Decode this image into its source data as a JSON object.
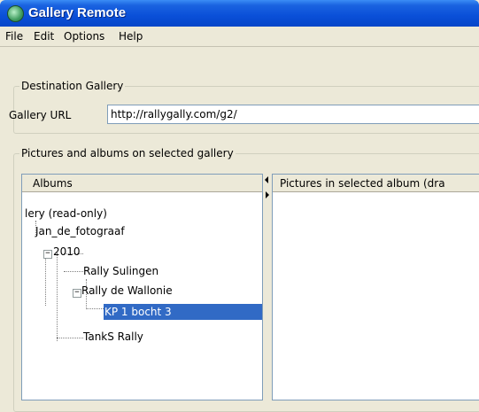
{
  "window": {
    "title": "Gallery Remote"
  },
  "menu": [
    "File",
    "Edit",
    "Options",
    "Help"
  ],
  "destination": {
    "legend": "Destination Gallery",
    "url_label": "Gallery URL",
    "url_value": "http://rallygally.com/g2/"
  },
  "pictures_section": {
    "legend": "Pictures and albums on selected gallery",
    "albums_header": "Albums",
    "pictures_header": "Pictures in selected album (dra"
  },
  "tree": [
    {
      "label": "lery (read-only)"
    },
    {
      "label": "Jan_de_fotograaf"
    },
    {
      "label": "2010",
      "expander": "−"
    },
    {
      "label": "Rally Sulingen"
    },
    {
      "label": "Rally de Wallonie",
      "expander": "−"
    },
    {
      "label": "KP 1 bocht 3",
      "selected": true
    },
    {
      "label": "TankS Rally"
    }
  ],
  "colors": {
    "title_bar": "#0a4fd8",
    "selection": "#316ac5",
    "background": "#ece9d8"
  },
  "icons": {
    "app": "gallery-remote-icon",
    "expander": "tree-expander-minus-icon"
  }
}
